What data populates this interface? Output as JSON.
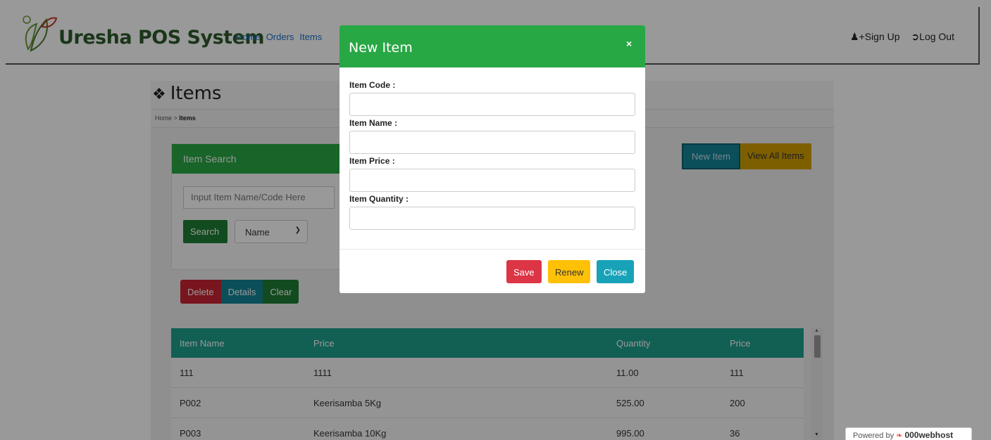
{
  "navbar": {
    "brand": "Uresha POS System",
    "links": [
      "Home",
      "Orders",
      "Items"
    ],
    "sign_up": "Sign Up",
    "log_out": "Log Out"
  },
  "page": {
    "title": "Items",
    "breadcrumb_home": "Home",
    "breadcrumb_sep": " > ",
    "breadcrumb_current": "Items"
  },
  "search": {
    "header": "Item Search",
    "placeholder": "Input Item Name/Code Here",
    "button": "Search",
    "select_value": "Name"
  },
  "actions": {
    "delete": "Delete",
    "details": "Details",
    "clear": "Clear",
    "new_item": "New Item",
    "view_all": "View All Items"
  },
  "table": {
    "headers": [
      "Item Name",
      "Price",
      "Quantity",
      "Price"
    ],
    "rows": [
      [
        "111",
        "1111",
        "11.00",
        "111"
      ],
      [
        "P002",
        "Keerisamba 5Kg",
        "525.00",
        "200"
      ],
      [
        "P003",
        "Keerisamba 10Kg",
        "995.00",
        "36"
      ]
    ]
  },
  "modal": {
    "title": "New Item",
    "close_symbol": "×",
    "fields": [
      {
        "label": "Item Code :",
        "value": ""
      },
      {
        "label": "Item Name :",
        "value": ""
      },
      {
        "label": "Item Price :",
        "value": ""
      },
      {
        "label": "Item Quantity :",
        "value": ""
      }
    ],
    "save": "Save",
    "renew": "Renew",
    "close": "Close"
  },
  "footer": {
    "powered_by": "Powered by",
    "host": "000webhost"
  },
  "colors": {
    "header_green": "#28a745",
    "table_teal": "#1f9e8d",
    "danger": "#dc3545",
    "warning": "#ffc107",
    "info": "#17a2b8"
  }
}
